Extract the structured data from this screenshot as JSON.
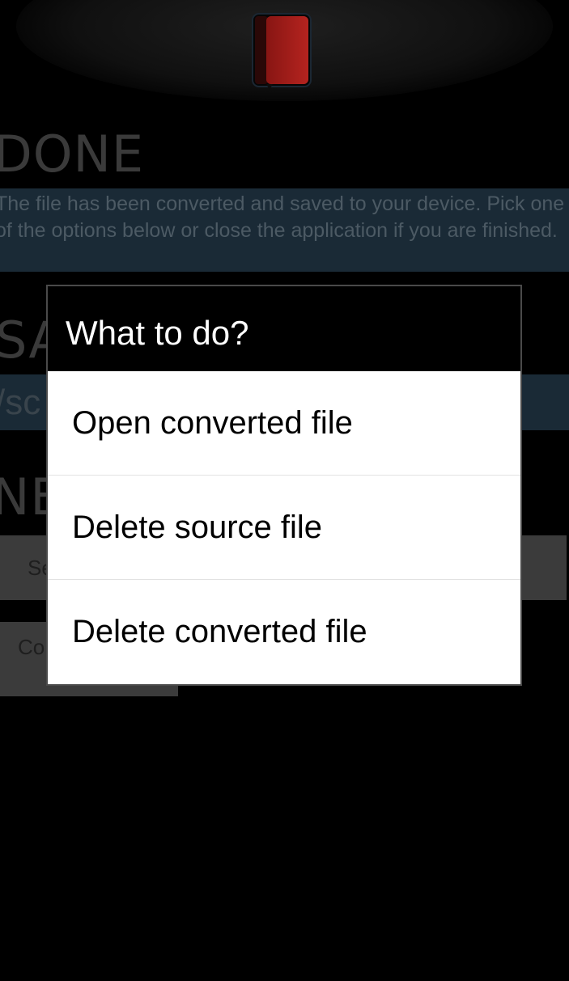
{
  "background": {
    "logo_icon": "book-icon",
    "done_heading": "DONE",
    "done_message": "The file has been converted and saved to your device. Pick one of the options below or close the application if you are finished.",
    "saved_heading": "SAVED TO",
    "saved_path": "/sc",
    "next_heading": "NE",
    "send_button_label": "Se",
    "convert_button_label": "Co"
  },
  "dialog": {
    "title": "What to do?",
    "options": [
      {
        "label": "Open converted file"
      },
      {
        "label": "Delete source file"
      },
      {
        "label": "Delete converted file"
      }
    ]
  },
  "colors": {
    "logo_red": "#b0201c",
    "info_box": "#1a2a36",
    "dialog_title_bg": "#000000",
    "dialog_list_bg": "#ffffff"
  }
}
